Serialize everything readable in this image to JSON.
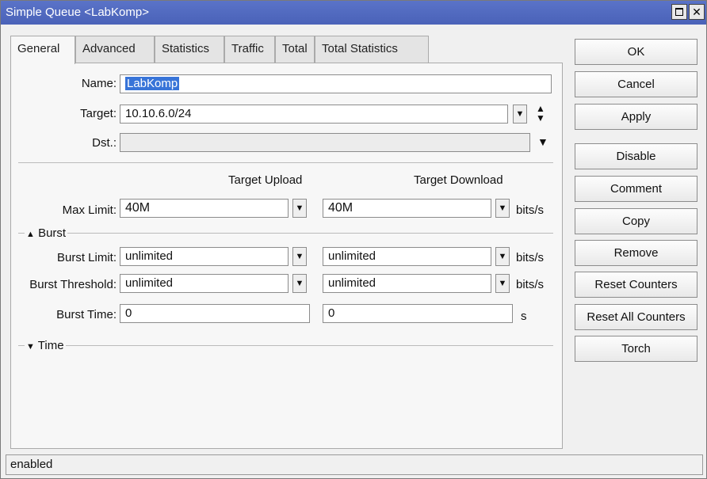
{
  "window": {
    "title": "Simple Queue <LabKomp>",
    "title_bg": "#4a62b8"
  },
  "tabs": [
    {
      "label": "General",
      "active": true
    },
    {
      "label": "Advanced"
    },
    {
      "label": "Statistics"
    },
    {
      "label": "Traffic"
    },
    {
      "label": "Total"
    },
    {
      "label": "Total Statistics"
    }
  ],
  "form": {
    "name_label": "Name:",
    "name_value": "LabKomp",
    "target_label": "Target:",
    "target_value": "10.10.6.0/24",
    "dst_label": "Dst.:",
    "dst_value": "",
    "col_upload": "Target Upload",
    "col_download": "Target Download",
    "max_limit_label": "Max Limit:",
    "max_limit_upload": "40M",
    "max_limit_download": "40M",
    "unit_bits": "bits/s",
    "burst_section": "Burst",
    "burst_limit_label": "Burst Limit:",
    "burst_limit_upload": "unlimited",
    "burst_limit_download": "unlimited",
    "burst_threshold_label": "Burst Threshold:",
    "burst_threshold_upload": "unlimited",
    "burst_threshold_download": "unlimited",
    "burst_time_label": "Burst Time:",
    "burst_time_upload": "0",
    "burst_time_download": "0",
    "unit_s": "s",
    "time_section": "Time"
  },
  "buttons": {
    "ok": "OK",
    "cancel": "Cancel",
    "apply": "Apply",
    "disable": "Disable",
    "comment": "Comment",
    "copy": "Copy",
    "remove": "Remove",
    "reset_counters": "Reset Counters",
    "reset_all_counters": "Reset All Counters",
    "torch": "Torch"
  },
  "status": {
    "text": "enabled"
  }
}
